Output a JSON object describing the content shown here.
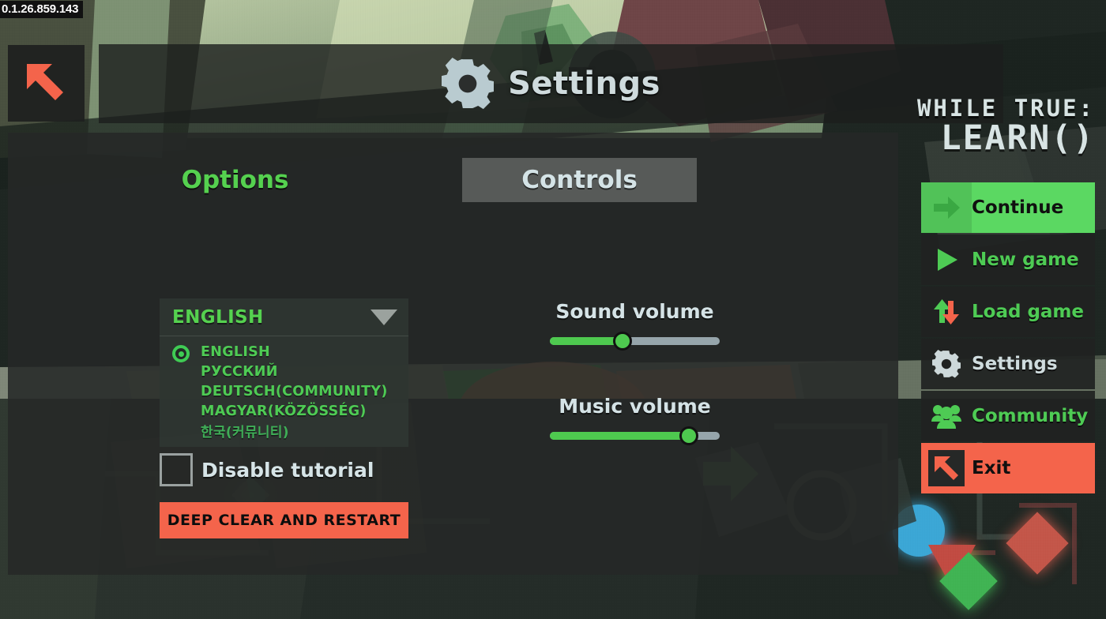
{
  "version": "0.1.26.859.143",
  "header": {
    "title": "Settings",
    "gear_icon": "gear-icon",
    "back_icon": "back-arrow-icon"
  },
  "tabs": [
    {
      "label": "Options",
      "state": "active"
    },
    {
      "label": "Controls",
      "state": "hover"
    }
  ],
  "options": {
    "language_select": {
      "value": "ENGLISH",
      "caret_icon": "chevron-down-icon",
      "expanded": true,
      "options": [
        "ENGLISH",
        "РУССКИЙ",
        "DEUTSCH(COMMUNITY)",
        "MAGYAR(KÖZÖSSÉG)",
        "한국(커뮤니티)"
      ],
      "selected_index": 0
    },
    "tutorial": {
      "label": "Disable tutorial",
      "checked": false
    },
    "deep_clear_label": "DEEP CLEAR AND RESTART"
  },
  "audio": {
    "sound": {
      "label": "Sound volume",
      "value": 43
    },
    "music": {
      "label": "Music volume",
      "value": 82
    }
  },
  "logo": {
    "line1": "WHILE TRUE:",
    "line2": "LEARN()"
  },
  "menu": [
    {
      "label": "Continue",
      "icon": "arrow-right-icon",
      "state": "active"
    },
    {
      "label": "New game",
      "icon": "play-icon",
      "state": "normal"
    },
    {
      "label": "Load game",
      "icon": "load-refresh-icon",
      "state": "normal"
    },
    {
      "label": "Settings",
      "icon": "gear-icon",
      "state": "current"
    },
    {
      "label": "Community",
      "icon": "people-icon",
      "state": "normal"
    },
    {
      "label": "Exit",
      "icon": "exit-arrow-icon",
      "state": "danger"
    }
  ],
  "colors": {
    "green": "#4ecb54",
    "green_bright": "#5bd862",
    "red": "#f4644b",
    "text_light": "#d5e3e6",
    "panel": "#262827",
    "slider_track": "#96a5ab"
  }
}
